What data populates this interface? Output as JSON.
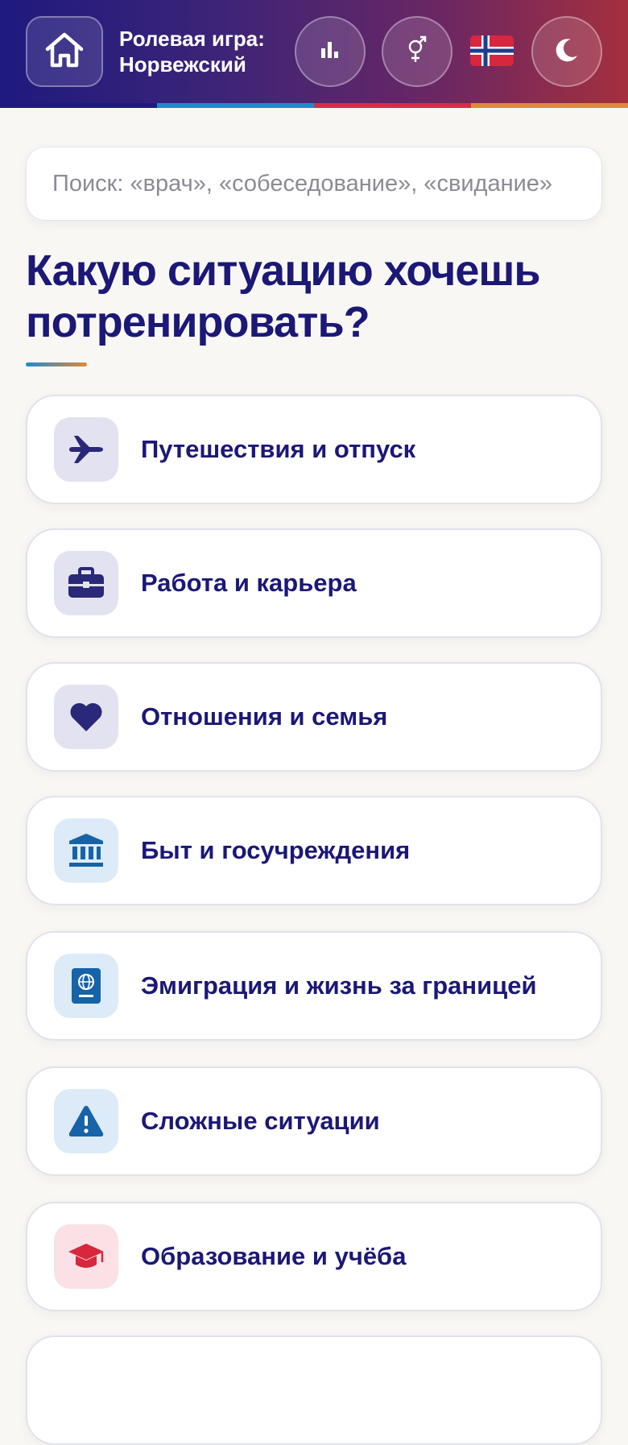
{
  "header": {
    "title_line1": "Ролевая игра:",
    "title_line2": "Норвежский",
    "gradient": [
      "#1e1a7e",
      "#a52f3e"
    ],
    "stripe_colors": [
      "#1e1a7e",
      "#1f8ad0",
      "#d92a4a",
      "#e0893a"
    ],
    "buttons": [
      {
        "name": "home-icon"
      },
      {
        "name": "stats-icon"
      },
      {
        "name": "gender-icon"
      },
      {
        "name": "norway-flag-icon"
      },
      {
        "name": "moon-icon"
      }
    ]
  },
  "search": {
    "placeholder": "Поиск: «врач», «собеседование», «свидание»"
  },
  "heading": {
    "text": "Какую ситуацию хочешь потренировать?"
  },
  "categories": [
    {
      "label": "Путешествия и отпуск",
      "icon": "airplane-icon",
      "icon_bg": "#e3e2f0",
      "icon_color": "#2a2878"
    },
    {
      "label": "Работа и карьера",
      "icon": "briefcase-icon",
      "icon_bg": "#e3e2f0",
      "icon_color": "#2a2878"
    },
    {
      "label": "Отношения и семья",
      "icon": "heart-icon",
      "icon_bg": "#e3e2f0",
      "icon_color": "#2a2878"
    },
    {
      "label": "Быт и госучреждения",
      "icon": "bank-icon",
      "icon_bg": "#dcebf7",
      "icon_color": "#1663a8"
    },
    {
      "label": "Эмиграция и жизнь за границей",
      "icon": "passport-icon",
      "icon_bg": "#dcebf7",
      "icon_color": "#1663a8"
    },
    {
      "label": "Сложные ситуации",
      "icon": "warning-icon",
      "icon_bg": "#dcebf7",
      "icon_color": "#1663a8"
    },
    {
      "label": "Образование и учёба",
      "icon": "graduation-cap-icon",
      "icon_bg": "#fbe1e5",
      "icon_color": "#d7263d"
    }
  ]
}
